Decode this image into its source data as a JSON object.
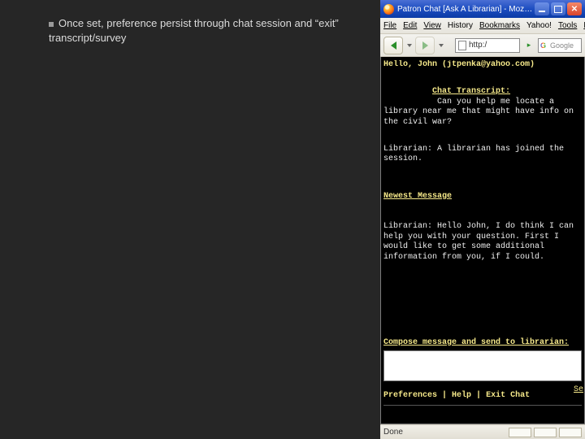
{
  "caption": {
    "text": "Once set, preference persist through chat session and “exit” transcript/survey"
  },
  "window": {
    "title": "Patron Chat [Ask A Librarian] - Mozilla Fire…"
  },
  "menubar": {
    "file": "File",
    "edit": "Edit",
    "view": "View",
    "history": "History",
    "bookmarks": "Bookmarks",
    "yahoo": "Yahoo!",
    "tools": "Tools",
    "help": "Help"
  },
  "toolbar": {
    "url": "http:/",
    "search_placeholder": "Google"
  },
  "chat": {
    "greeting": "Hello, John (jtpenka@yahoo.com)",
    "transcript_label": "Chat Transcript:",
    "transcript_q": "Can you help me locate a library near me that might have info on the civil war?",
    "joined": "Librarian: A librarian has joined the session.",
    "newest_label": "Newest Message",
    "newest_body": "Librarian: Hello John, I do think I can help you with your question. First I would like to get some additional information from you, if I could.",
    "compose_label": "Compose message and send to librarian:",
    "send": "Se",
    "footer_prefs": "Preferences",
    "footer_help": "Help",
    "footer_exit": "Exit Chat",
    "sep": " | "
  },
  "statusbar": {
    "done": "Done"
  }
}
